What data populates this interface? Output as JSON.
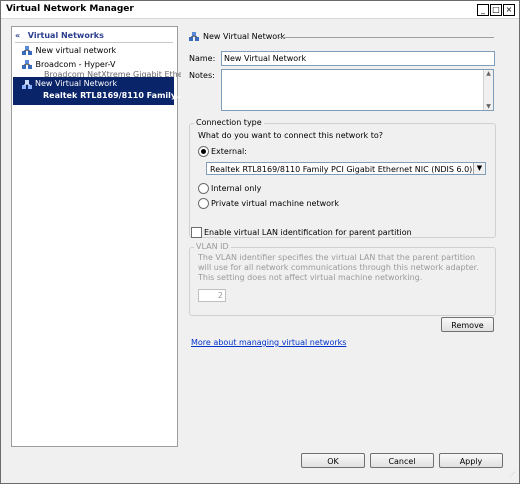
{
  "window": {
    "title": "Virtual Network Manager",
    "minimize": "_",
    "restore": "□",
    "close": "×"
  },
  "tree": {
    "heading": "Virtual Networks",
    "collapse_glyph": "«",
    "items": [
      {
        "label": "New virtual network"
      },
      {
        "label": "Broadcom - Hyper-V",
        "sub": "Broadcom NetXtreme Gigabit Ether..."
      },
      {
        "label": "New Virtual Network",
        "sub": "Realtek RTL8169/8110 Family..."
      }
    ]
  },
  "panel": {
    "heading": "New Virtual Network",
    "name_label": "Name:",
    "name_value": "New Virtual Network",
    "notes_label": "Notes:",
    "notes_value": "",
    "connection": {
      "group_label": "Connection type",
      "question": "What do you want to connect this network to?",
      "external_label": "External:",
      "adapter_value": "Realtek RTL8169/8110 Family PCI Gigabit Ethernet NIC (NDIS 6.0)",
      "internal_label": "Internal only",
      "private_label": "Private virtual machine network",
      "selected": "external"
    },
    "vlan": {
      "checkbox_label": "Enable virtual LAN identification for parent partition",
      "checked": false,
      "group_label": "VLAN ID",
      "description": "The VLAN identifier specifies the virtual LAN that the parent partition will use for all network communications through this network adapter. This setting does not affect virtual machine networking.",
      "value": "2"
    },
    "remove_label": "Remove",
    "link_text": "More about managing virtual networks"
  },
  "footer": {
    "ok_label": "OK",
    "cancel_label": "Cancel",
    "apply_label": "Apply"
  },
  "colors": {
    "selection": "#0a246a",
    "link": "#0033cc",
    "accent": "#2a3d8f"
  }
}
